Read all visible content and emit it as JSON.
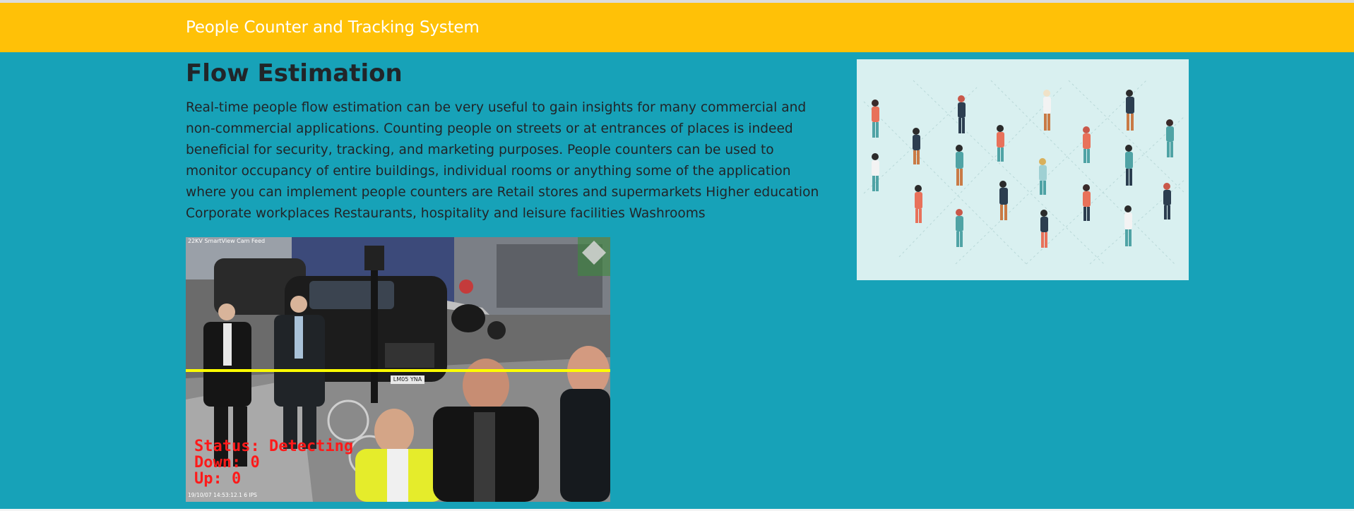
{
  "app": {
    "brand": "People Counter and Tracking System"
  },
  "main": {
    "title": "Flow Estimation",
    "description": "Real-time people flow estimation can be very useful to gain insights for many commercial and non-commercial applications. Counting people on streets or at entrances of places is indeed beneficial for security, tracking, and marketing purposes. People counters can be used to monitor occupancy of entire buildings, individual rooms or anything some of the application where you can implement people counters are Retail stores and supermarkets Higher education Corporate workplaces Restaurants, hospitality and leisure facilities Washrooms"
  },
  "video": {
    "overlay_status": "Status: Detecting",
    "overlay_down": "Down: 0",
    "overlay_up": "Up: 0",
    "camera_label": "22KV SmartView Cam Feed",
    "timestamp": "19/10/07 14:53:12.1 6 IPS",
    "plate": "LM05 YNA",
    "line_color": "#ffff00"
  },
  "colors": {
    "navbar": "#ffc107",
    "background": "#17a2b8",
    "illustration_bg": "#d9f0f0"
  }
}
